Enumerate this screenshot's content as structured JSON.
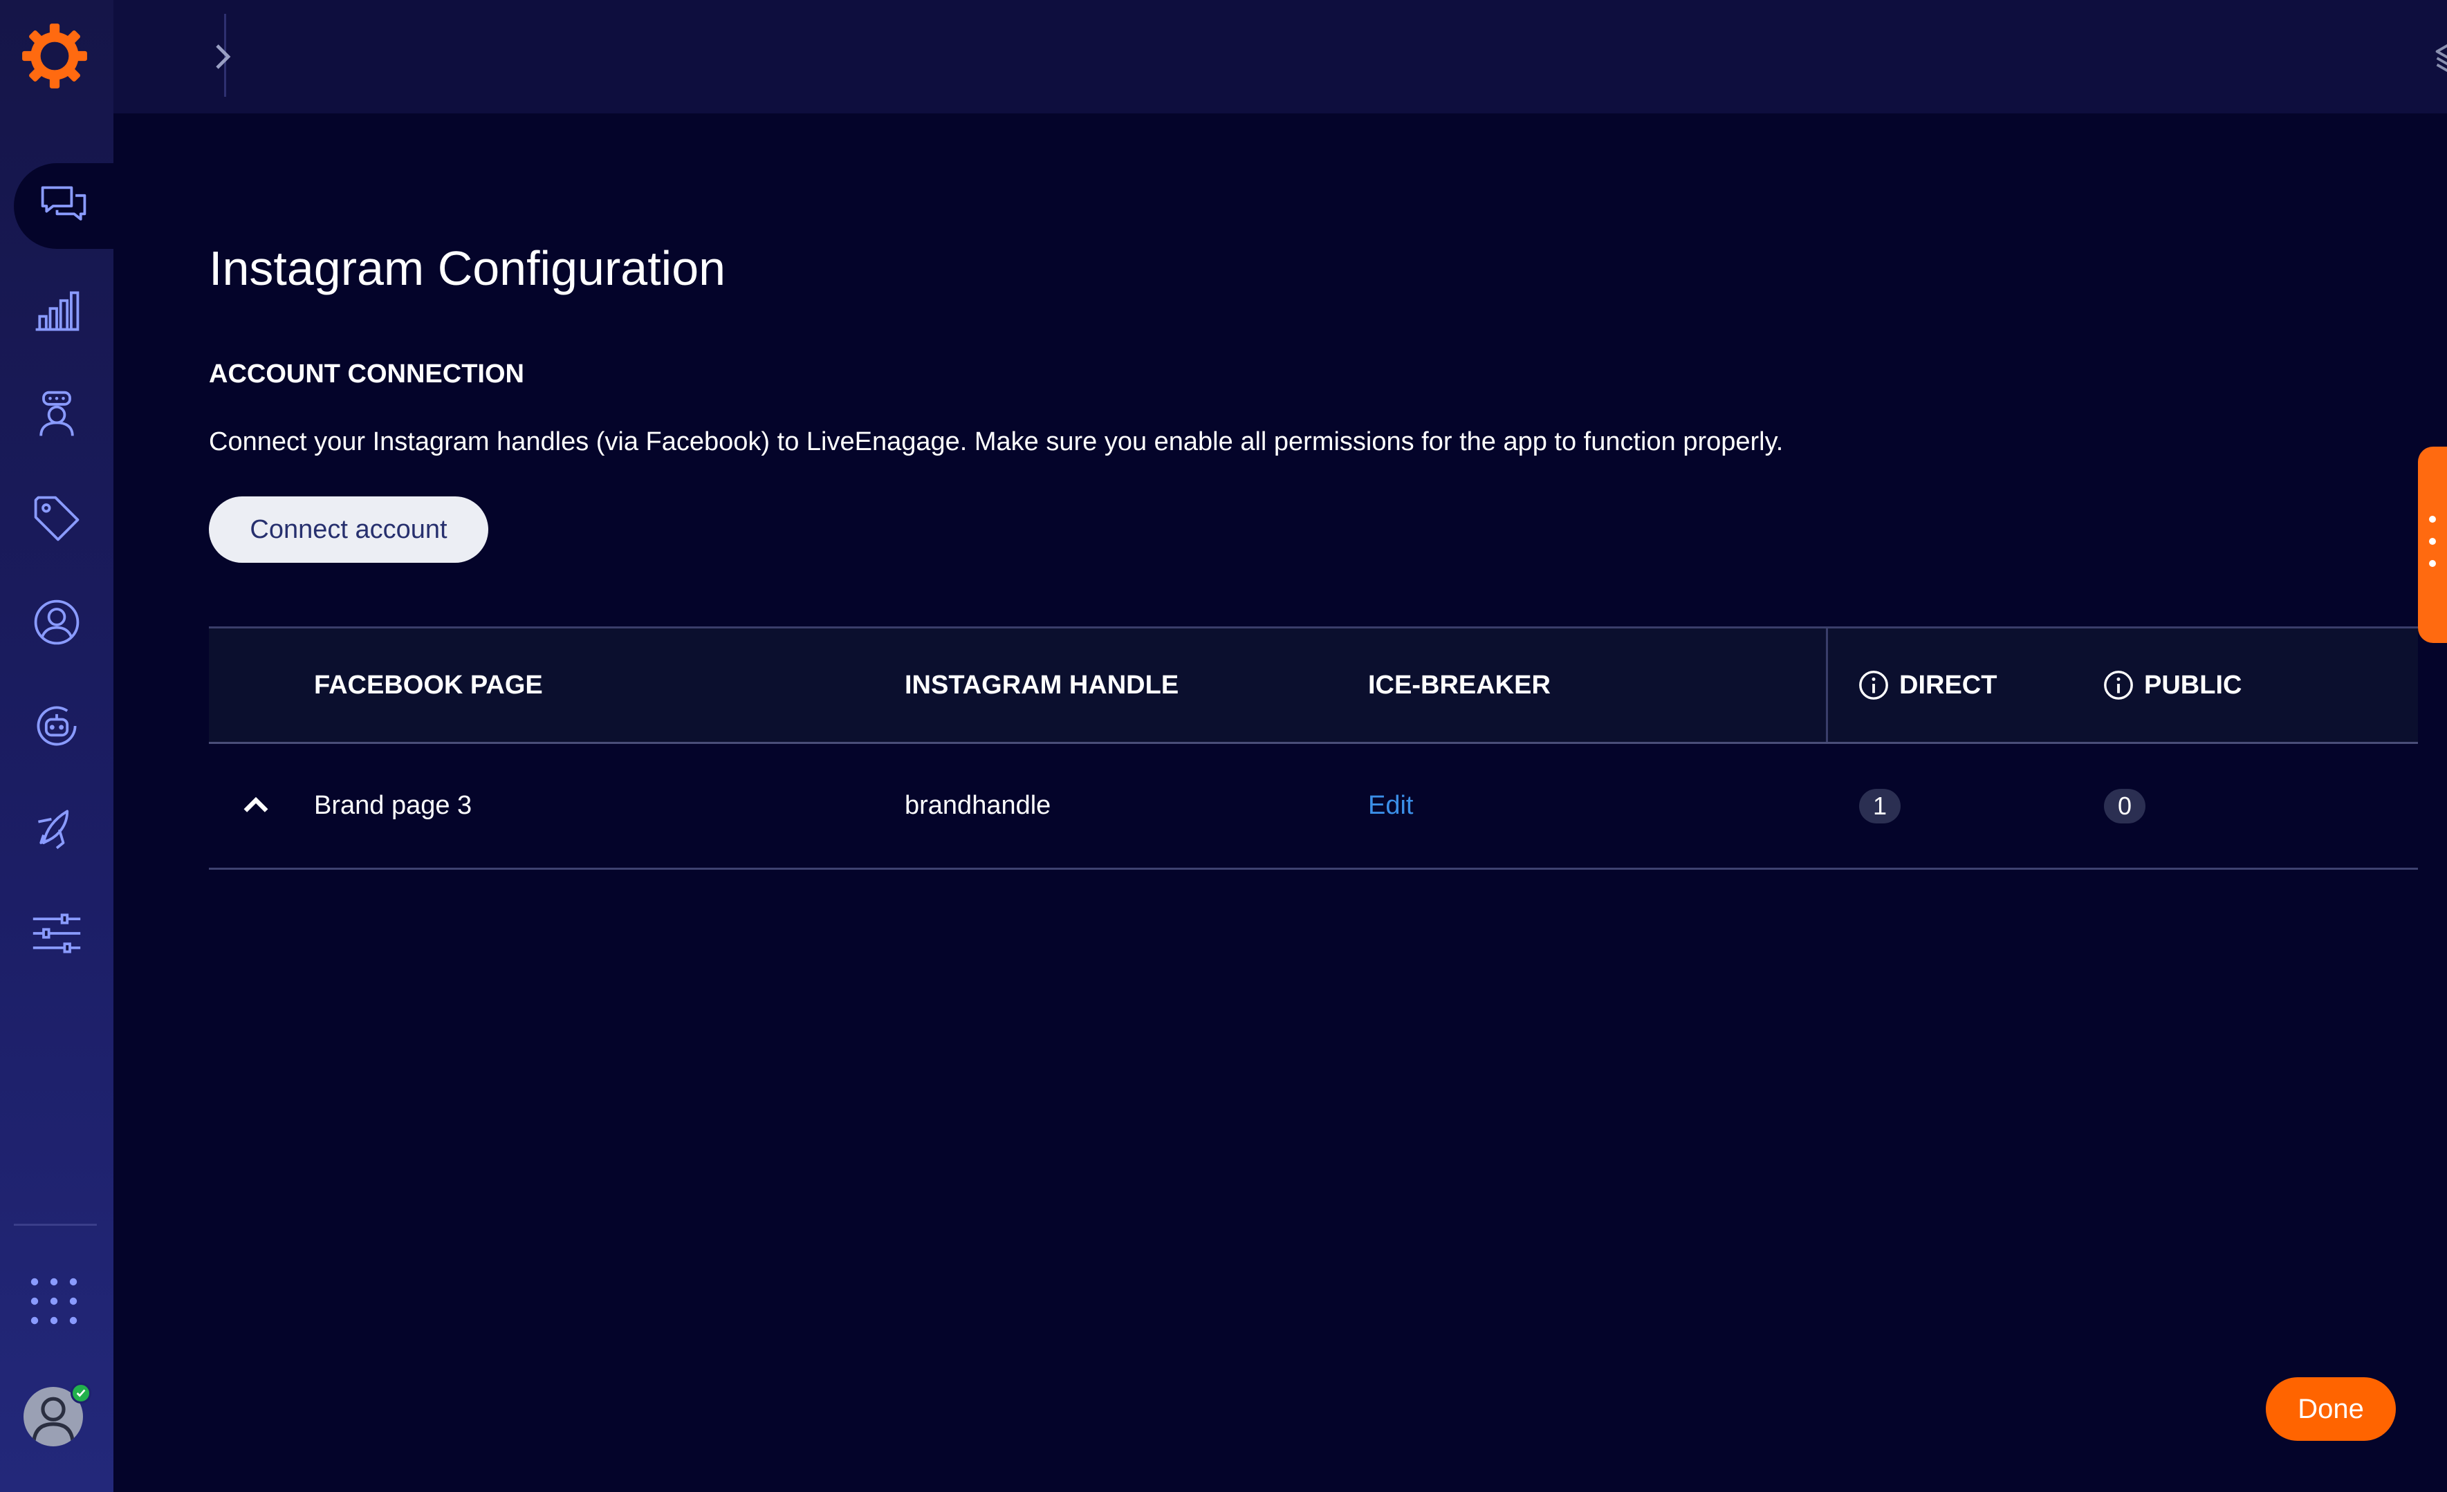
{
  "page": {
    "title": "Instagram Configuration",
    "section_title": "ACCOUNT CONNECTION",
    "description": "Connect your Instagram handles (via Facebook) to LiveEnagage. Make sure you enable all permissions for the app to function properly.",
    "connect_button": "Connect account",
    "done_button": "Done"
  },
  "table": {
    "columns": {
      "facebook_page": "FACEBOOK PAGE",
      "instagram_handle": "INSTAGRAM HANDLE",
      "ice_breaker": "ICE-BREAKER",
      "direct": "DIRECT",
      "public": "PUBLIC"
    },
    "rows": [
      {
        "facebook_page": "Brand page 3",
        "instagram_handle": "brandhandle",
        "ice_breaker": "Edit",
        "direct": "1",
        "public": "0"
      }
    ]
  },
  "sidebar": {
    "items": [
      {
        "icon": "conversations-icon",
        "active": true
      },
      {
        "icon": "analytics-icon",
        "active": false
      },
      {
        "icon": "agent-icon",
        "active": false
      },
      {
        "icon": "tag-icon",
        "active": false
      },
      {
        "icon": "user-profile-icon",
        "active": false
      },
      {
        "icon": "bot-icon",
        "active": false
      },
      {
        "icon": "campaign-icon",
        "active": false
      },
      {
        "icon": "settings-sliders-icon",
        "active": false
      }
    ]
  },
  "colors": {
    "background": "#04042a",
    "accent": "#ff6400",
    "link": "#3b8fe8",
    "sidebar": "#1c1e66"
  }
}
